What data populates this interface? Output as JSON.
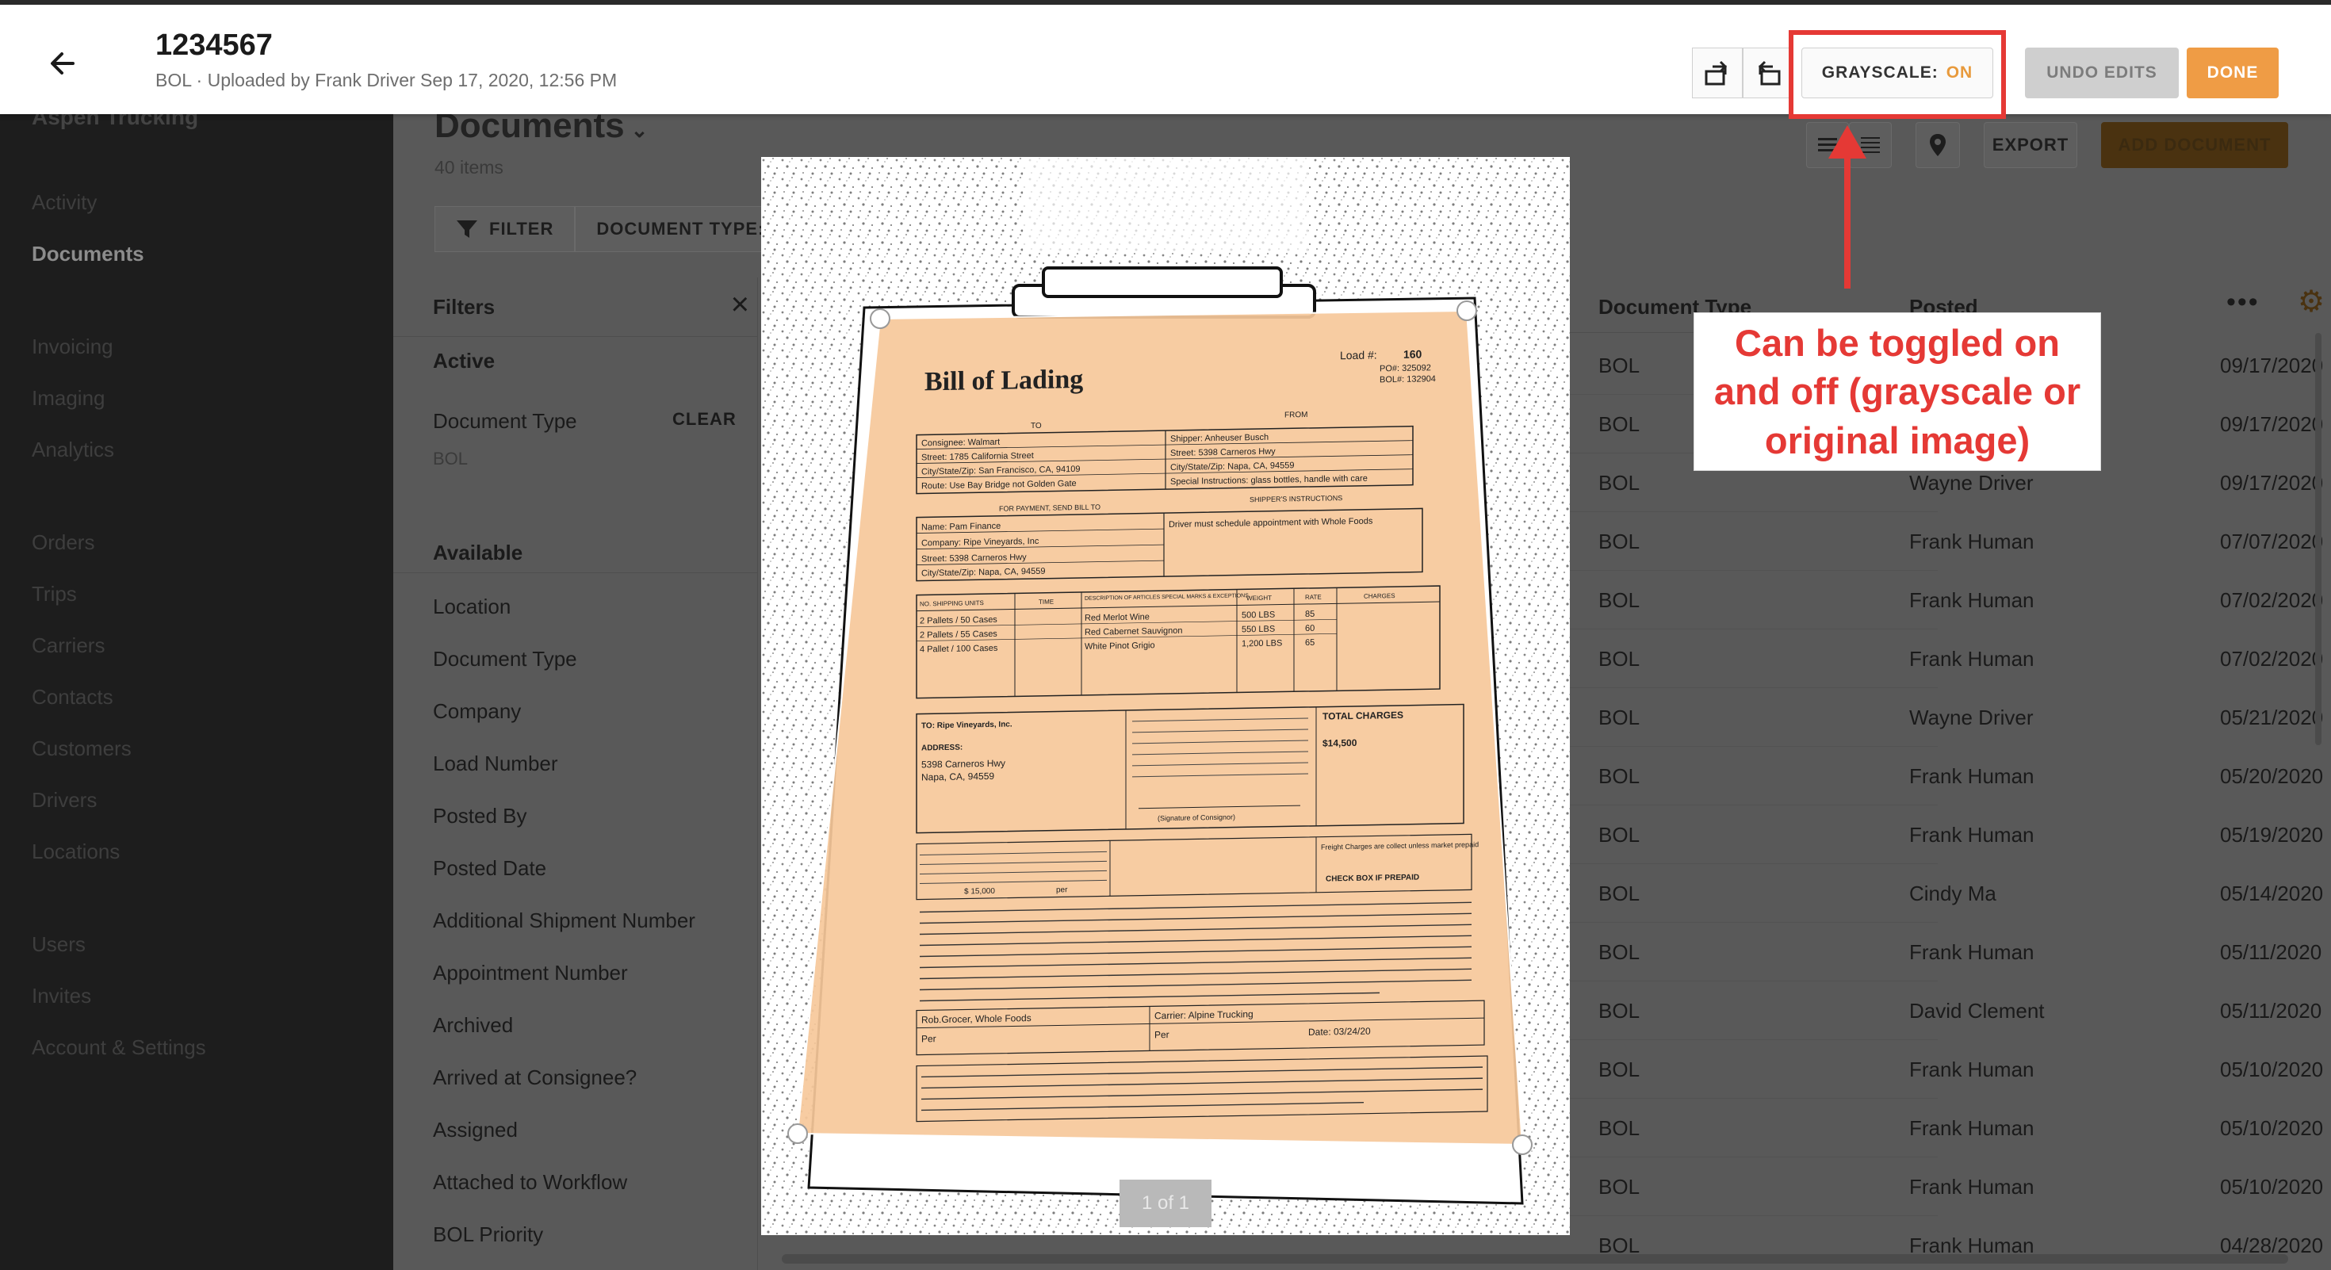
{
  "header": {
    "title": "1234567",
    "subtitle": "BOL · Uploaded by Frank Driver Sep 17, 2020, 12:56 PM",
    "grayscale_label": "GRAYSCALE:",
    "grayscale_state": "ON",
    "undo_label": "UNDO EDITS",
    "done_label": "DONE",
    "colors": {
      "accent": "#ef9c45",
      "highlight": "#e53935"
    }
  },
  "sidebar": {
    "company": "Aspen Trucking",
    "items": [
      {
        "label": "Activity",
        "active": false
      },
      {
        "label": "Documents",
        "active": true
      },
      {
        "label": "Invoicing",
        "active": false
      },
      {
        "label": "Imaging",
        "active": false
      },
      {
        "label": "Analytics",
        "active": false
      },
      {
        "label": "Orders",
        "active": false
      },
      {
        "label": "Trips",
        "active": false
      },
      {
        "label": "Carriers",
        "active": false
      },
      {
        "label": "Contacts",
        "active": false
      },
      {
        "label": "Customers",
        "active": false
      },
      {
        "label": "Drivers",
        "active": false
      },
      {
        "label": "Locations",
        "active": false
      },
      {
        "label": "Users",
        "active": false
      },
      {
        "label": "Invites",
        "active": false
      },
      {
        "label": "Account & Settings",
        "active": false
      }
    ]
  },
  "documents": {
    "heading": "Documents",
    "item_count": "40 items",
    "filter_label": "FILTER",
    "doc_type_label": "DOCUMENT TYPE: B",
    "export_label": "EXPORT",
    "add_document_label": "ADD DOCUMENT"
  },
  "filters": {
    "title": "Filters",
    "active_label": "Active",
    "active_filter": "Document Type",
    "active_value": "BOL",
    "clear_label": "CLEAR",
    "available_label": "Available",
    "available": [
      "Location",
      "Document Type",
      "Company",
      "Load Number",
      "Posted By",
      "Posted Date",
      "Additional Shipment Number",
      "Appointment Number",
      "Archived",
      "Arrived at Consignee?",
      "Assigned",
      "Attached to Workflow",
      "BOL Priority"
    ]
  },
  "table": {
    "columns": [
      "Document Type",
      "Posted By"
    ],
    "rows": [
      {
        "type": "BOL",
        "posted_by": "",
        "date": "09/17/2020"
      },
      {
        "type": "BOL",
        "posted_by": "",
        "date": "09/17/2020"
      },
      {
        "type": "BOL",
        "posted_by": "Wayne Driver",
        "date": "09/17/2020"
      },
      {
        "type": "BOL",
        "posted_by": "Frank Human",
        "date": "07/07/2020"
      },
      {
        "type": "BOL",
        "posted_by": "Frank Human",
        "date": "07/02/2020"
      },
      {
        "type": "BOL",
        "posted_by": "Frank Human",
        "date": "07/02/2020"
      },
      {
        "type": "BOL",
        "posted_by": "Wayne Driver",
        "date": "05/21/2020"
      },
      {
        "type": "BOL",
        "posted_by": "Frank Human",
        "date": "05/20/2020"
      },
      {
        "type": "BOL",
        "posted_by": "Frank Human",
        "date": "05/19/2020"
      },
      {
        "type": "BOL",
        "posted_by": "Cindy Ma",
        "date": "05/14/2020"
      },
      {
        "type": "BOL",
        "posted_by": "Frank Human",
        "date": "05/11/2020"
      },
      {
        "type": "BOL",
        "posted_by": "David Clement",
        "date": "05/11/2020"
      },
      {
        "type": "BOL",
        "posted_by": "Frank Human",
        "date": "05/10/2020"
      },
      {
        "type": "BOL",
        "posted_by": "Frank Human",
        "date": "05/10/2020"
      },
      {
        "type": "BOL",
        "posted_by": "Frank Human",
        "date": "05/10/2020"
      },
      {
        "type": "BOL",
        "posted_by": "Frank Human",
        "date": "04/28/2020"
      }
    ]
  },
  "preview": {
    "page_counter": "1 of 1",
    "bol": {
      "title": "Bill of Lading",
      "load_no": "Load #:",
      "load_val": "160",
      "po": "PO#: 325092",
      "bol_no": "BOL#: 132904",
      "to": "TO",
      "from": "FROM",
      "consignee": "Consignee: Walmart",
      "street_to": "Street: 1785 California Street",
      "city_to": "City/State/Zip: San Francisco, CA, 94109",
      "route": "Route: Use Bay Bridge not Golden Gate",
      "shipper": "Shipper: Anheuser Busch",
      "street_from": "Street: 5398 Carneros Hwy",
      "city_from": "City/State/Zip: Napa, CA, 94559",
      "special": "Special Instructions: glass bottles, handle with care",
      "payment_header": "FOR PAYMENT, SEND BILL TO",
      "shipper_instr_header": "SHIPPER'S INSTRUCTIONS",
      "pay_name": "Name: Pam Finance",
      "pay_company": "Company: Ripe Vineyards, Inc",
      "pay_street": "Street: 5398 Carneros Hwy",
      "pay_city": "City/State/Zip: Napa, CA, 94559",
      "instr": "Driver must schedule appointment with Whole Foods",
      "col_units": "NO. SHIPPING UNITS",
      "col_time": "TIME",
      "col_desc": "DESCRIPTION OF ARTICLES SPECIAL MARKS & EXCEPTIONS",
      "col_weight": "WEIGHT",
      "col_rate": "RATE",
      "col_charges": "CHARGES",
      "items": [
        {
          "units": "2 Pallets / 50 Cases",
          "desc": "Red Merlot Wine",
          "weight": "500 LBS",
          "rate": "85"
        },
        {
          "units": "2 Pallets / 55 Cases",
          "desc": "Red Cabernet Sauvignon",
          "weight": "550 LBS",
          "rate": "60"
        },
        {
          "units": "4 Pallet / 100 Cases",
          "desc": "White Pinot Grigio",
          "weight": "1,200 LBS",
          "rate": "65"
        }
      ],
      "to_company": "TO: Ripe Vineyards, Inc.",
      "address_label": "ADDRESS:",
      "address_1": "5398 Carneros Hwy",
      "address_2": "Napa, CA, 94559",
      "total_label": "TOTAL CHARGES",
      "total_value": "$14,500",
      "consignor_sig": "(Signature of Consignor)",
      "freight_note": "Freight Charges are collect unless market prepaid",
      "check_box": "CHECK BOX IF PREPAID",
      "declared": "$ 15,000",
      "per_label": "per",
      "shipper_sig": "Rob.Grocer, Whole Foods",
      "carrier": "Carrier: Alpine Trucking",
      "per": "Per",
      "date": "Date: 03/24/20"
    }
  },
  "annotation": {
    "text": "Can be toggled on and off (grayscale or original image)"
  }
}
